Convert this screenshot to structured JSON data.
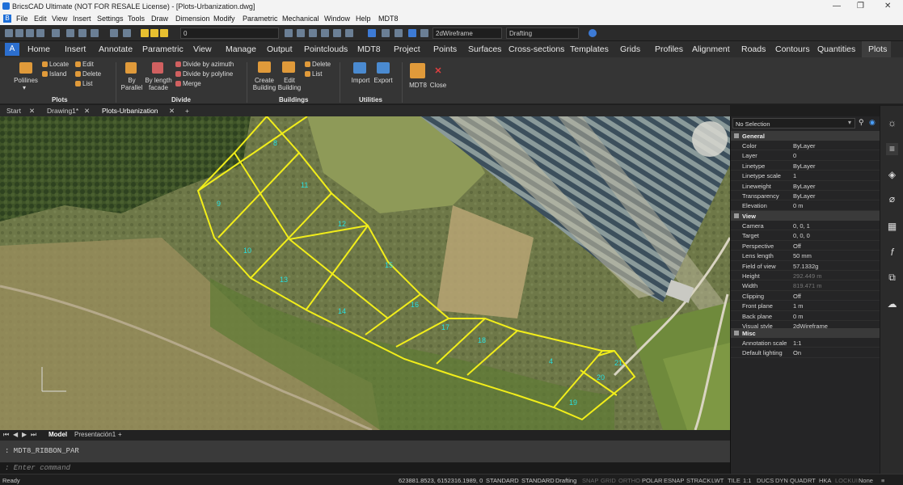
{
  "window": {
    "title": "BricsCAD Ultimate (NOT FOR RESALE License) - [Plots-Urbanization.dwg]",
    "min": "—",
    "max": "❐",
    "close": "✕"
  },
  "menu": [
    "File",
    "Edit",
    "View",
    "Insert",
    "Settings",
    "Tools",
    "Draw",
    "Dimension",
    "Modify",
    "Parametric",
    "Mechanical",
    "Window",
    "Help",
    "MDT8"
  ],
  "toolbar": {
    "layer": "0",
    "visual_style": "2dWireframe",
    "workspace": "Drafting"
  },
  "ribbon_tabs": [
    "Home",
    "Insert",
    "Annotate",
    "Parametric",
    "View",
    "Manage",
    "Output",
    "Pointclouds",
    "MDT8",
    "Project",
    "Points",
    "Surfaces",
    "Cross-sections",
    "Templates",
    "Grids",
    "Profiles",
    "Alignment",
    "Roads",
    "Contours",
    "Quantities",
    "Plots"
  ],
  "ribbon": {
    "plots": {
      "polylines": "Polilines",
      "locate": "Locate",
      "island": "Island",
      "edit": "Edit",
      "delete": "Delete",
      "list": "List",
      "group": "Plots"
    },
    "divide": {
      "by_parallel": "By\nParallel",
      "by_length": "By length\nfacade",
      "by_azimuth": "Divide by azimuth",
      "by_polyline": "Divide by polyline",
      "merge": "Merge",
      "group": "Divide"
    },
    "buildings": {
      "create": "Create\nBuilding",
      "edit": "Edit\nBuilding",
      "delete": "Delete",
      "list": "List",
      "group": "Buildings"
    },
    "utilities": {
      "import": "Import",
      "export": "Export",
      "group": "Utilities"
    },
    "mdt8": {
      "label": "MDT8",
      "close": "Close"
    }
  },
  "doc_tabs": [
    "Start",
    "Drawing1*",
    "Plots-Urbanization"
  ],
  "layout_tabs": [
    "Model",
    "Presentación1"
  ],
  "plot_labels": [
    "8",
    "9",
    "10",
    "11",
    "12",
    "13",
    "14",
    "15",
    "16",
    "17",
    "18",
    "19",
    "20",
    "21",
    "4"
  ],
  "command": {
    "history": ": MDT8_RIBBON_PAR",
    "prompt": ": Enter command"
  },
  "status": {
    "ready": "Ready",
    "coords": "623881.8523, 6152316.1989, 0",
    "std1": "STANDARD",
    "std2": "STANDARD",
    "ws": "Drafting",
    "toggles": [
      "SNAP",
      "GRID",
      "ORTHO",
      "POLAR",
      "ESNAP",
      "STRACK",
      "LWT",
      "TILE",
      "1:1",
      "DUCS",
      "DYN",
      "QUAD",
      "RT",
      "HKA",
      "LOCKUI",
      "None"
    ]
  },
  "properties": {
    "selection": "No Selection",
    "general_title": "General",
    "general": [
      [
        "Color",
        "ByLayer"
      ],
      [
        "Layer",
        "0"
      ],
      [
        "Linetype",
        "ByLayer"
      ],
      [
        "Linetype scale",
        "1"
      ],
      [
        "Lineweight",
        "ByLayer"
      ],
      [
        "Transparency",
        "ByLayer"
      ],
      [
        "Elevation",
        "0 m"
      ]
    ],
    "view_title": "View",
    "view": [
      [
        "Camera",
        "0, 0, 1"
      ],
      [
        "Target",
        "0, 0, 0"
      ],
      [
        "Perspective",
        "Off"
      ],
      [
        "Lens length",
        "50 mm"
      ],
      [
        "Field of view",
        "57.1332g"
      ],
      [
        "Height",
        "292.449 m"
      ],
      [
        "Width",
        "819.471 m"
      ],
      [
        "Clipping",
        "Off"
      ],
      [
        "Front plane",
        "1 m"
      ],
      [
        "Back plane",
        "0 m"
      ],
      [
        "Visual style",
        "2dWireframe"
      ]
    ],
    "misc_title": "Misc",
    "misc": [
      [
        "Annotation scale",
        "1:1"
      ],
      [
        "Default lighting",
        "On"
      ]
    ]
  }
}
